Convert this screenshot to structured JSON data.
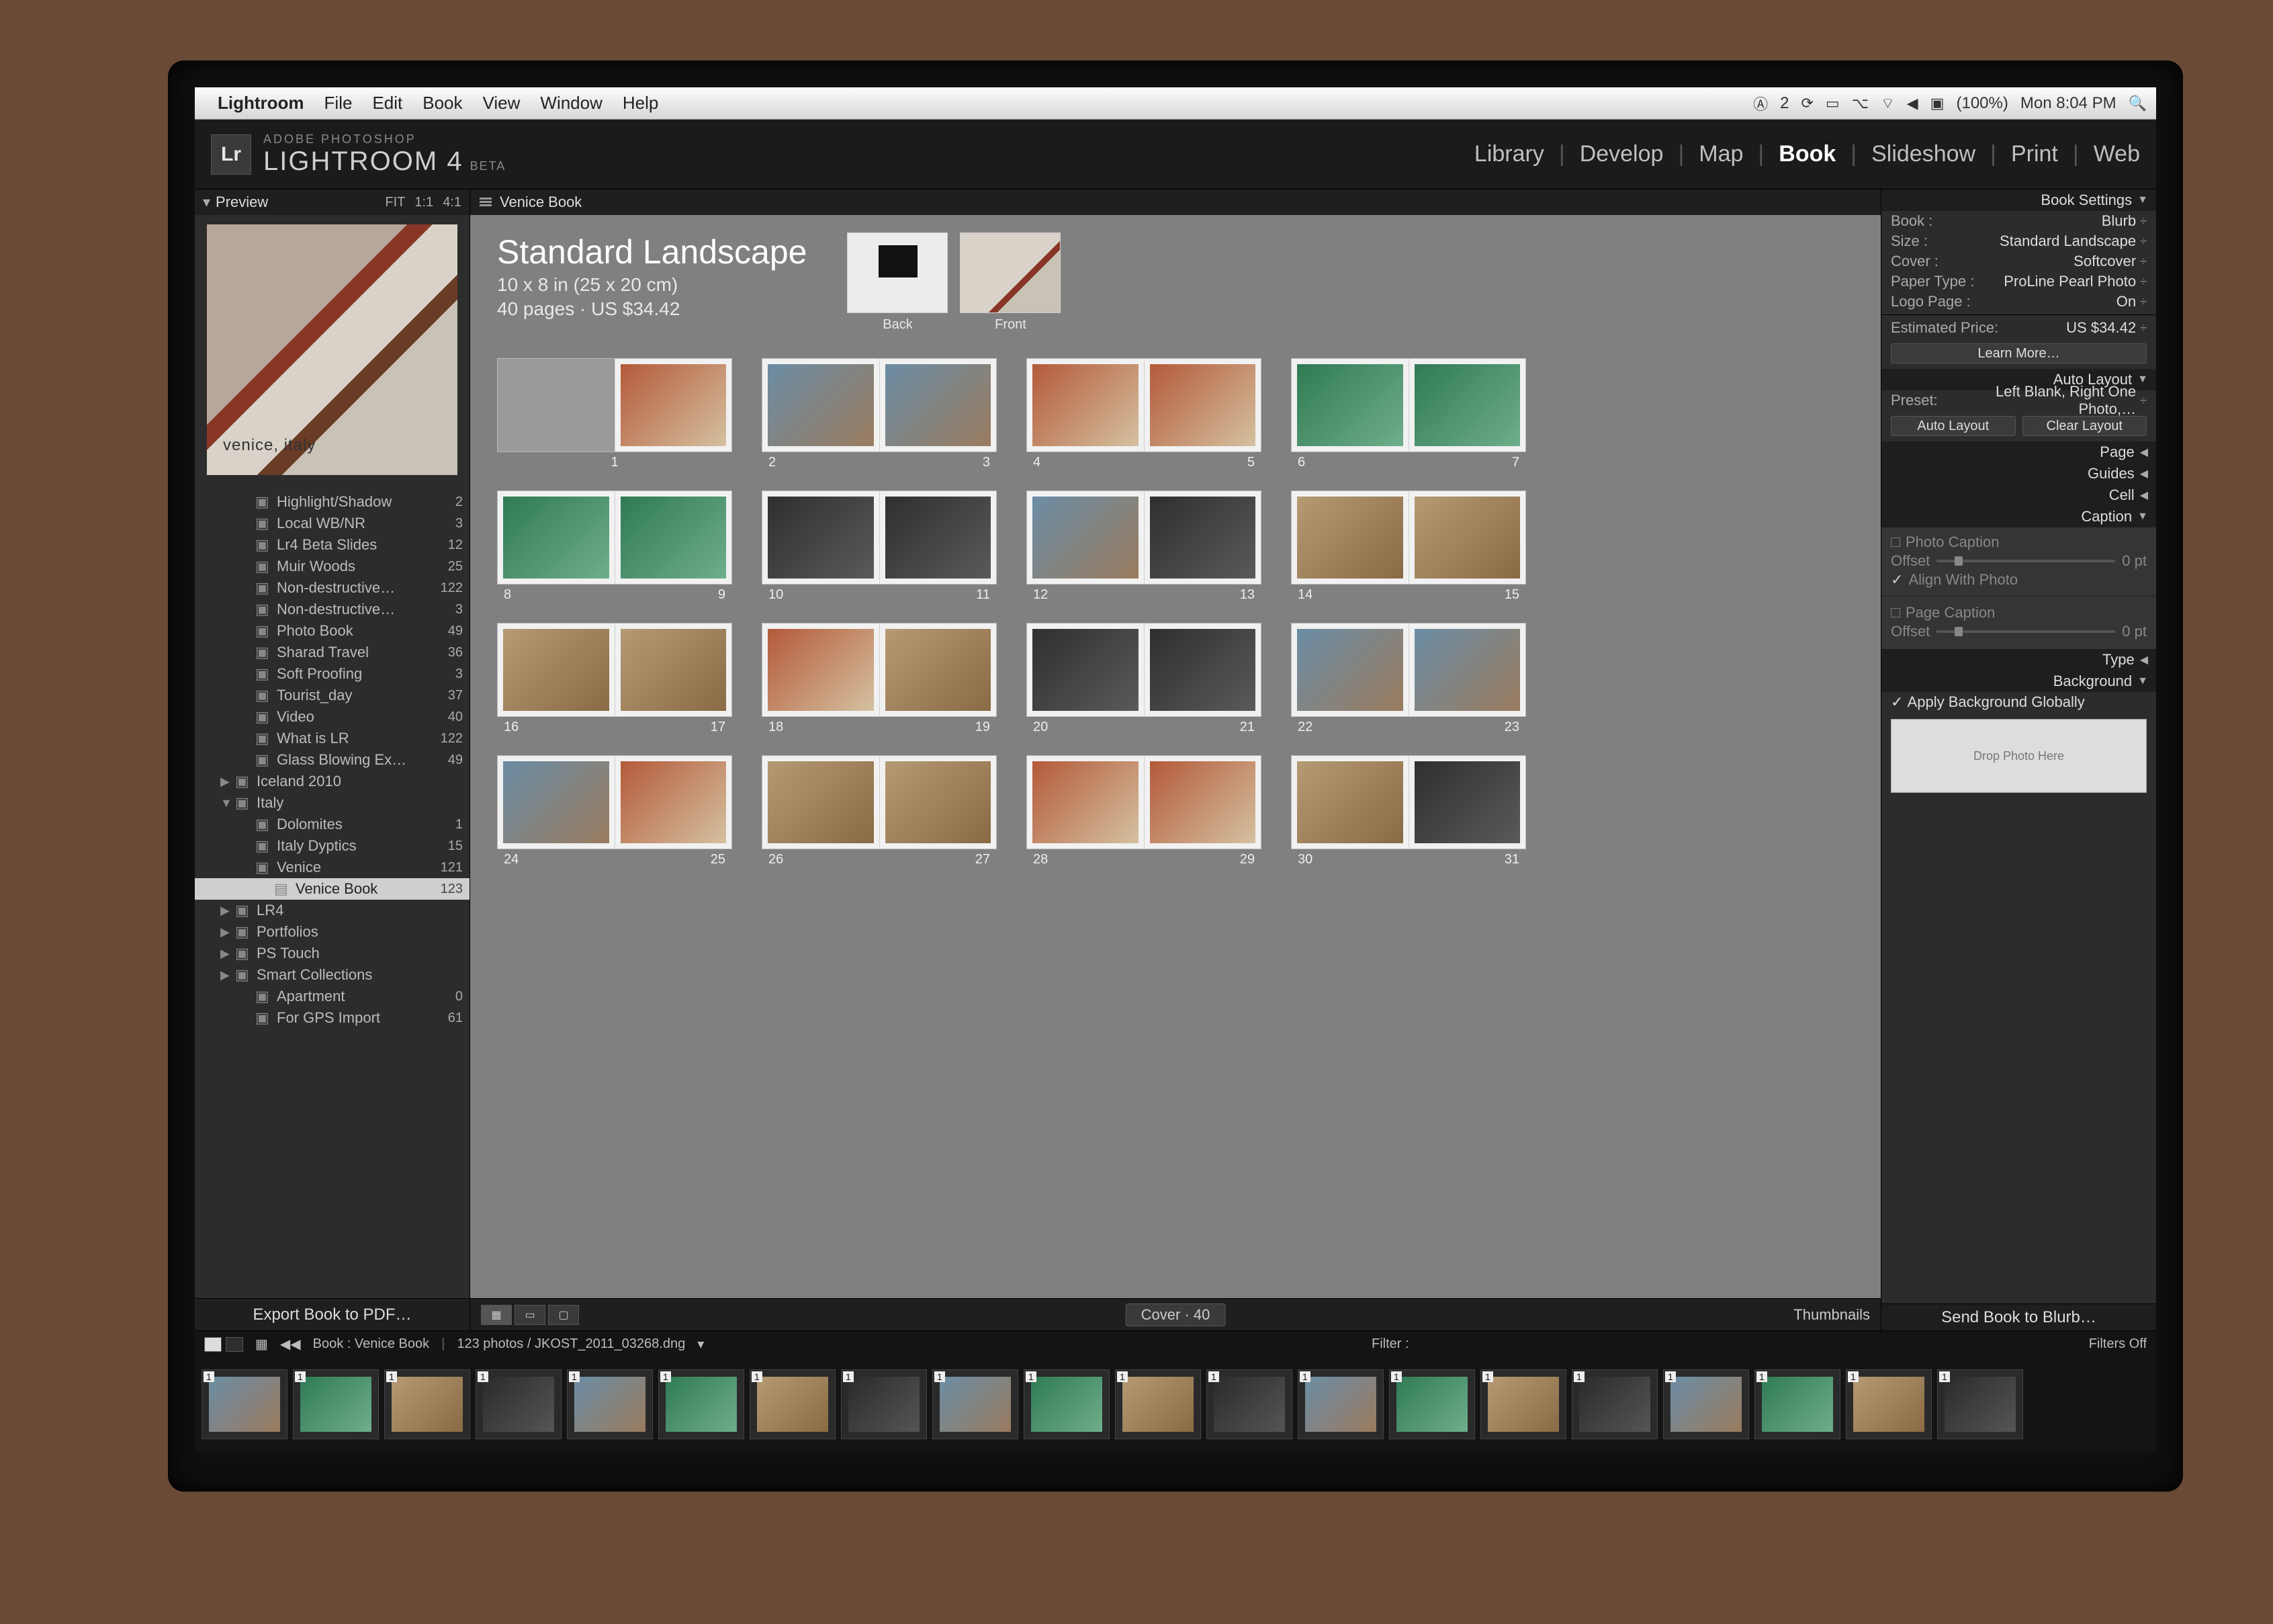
{
  "mac_menu": {
    "app": "Lightroom",
    "items": [
      "File",
      "Edit",
      "Book",
      "View",
      "Window",
      "Help"
    ],
    "status": {
      "a_count": "2",
      "battery": "(100%)",
      "clock": "Mon 8:04 PM"
    }
  },
  "app_header": {
    "badge": "Lr",
    "line1": "ADOBE PHOTOSHOP",
    "line2": "LIGHTROOM 4",
    "beta": "BETA",
    "modules": [
      "Library",
      "Develop",
      "Map",
      "Book",
      "Slideshow",
      "Print",
      "Web"
    ],
    "active_module": "Book"
  },
  "left": {
    "preview_label": "Preview",
    "zoom": [
      "FIT",
      "1:1",
      "4:1"
    ],
    "preview_caption": "venice, italy",
    "collections": [
      {
        "name": "Highlight/Shadow",
        "count": "2",
        "indent": 2
      },
      {
        "name": "Local WB/NR",
        "count": "3",
        "indent": 2
      },
      {
        "name": "Lr4 Beta Slides",
        "count": "12",
        "indent": 2
      },
      {
        "name": "Muir Woods",
        "count": "25",
        "indent": 2
      },
      {
        "name": "Non-destructive…",
        "count": "122",
        "indent": 2
      },
      {
        "name": "Non-destructive…",
        "count": "3",
        "indent": 2
      },
      {
        "name": "Photo Book",
        "count": "49",
        "indent": 2
      },
      {
        "name": "Sharad Travel",
        "count": "36",
        "indent": 2
      },
      {
        "name": "Soft Proofing",
        "count": "3",
        "indent": 2
      },
      {
        "name": "Tourist_day",
        "count": "37",
        "indent": 2
      },
      {
        "name": "Video",
        "count": "40",
        "indent": 2
      },
      {
        "name": "What is LR",
        "count": "122",
        "indent": 2
      },
      {
        "name": "Glass Blowing Ex…",
        "count": "49",
        "indent": 2
      },
      {
        "name": "Iceland 2010",
        "count": "",
        "indent": 1,
        "expandable": true
      },
      {
        "name": "Italy",
        "count": "",
        "indent": 1,
        "expandable": true,
        "open": true
      },
      {
        "name": "Dolomites",
        "count": "1",
        "indent": 2
      },
      {
        "name": "Italy Dyptics",
        "count": "15",
        "indent": 2
      },
      {
        "name": "Venice",
        "count": "121",
        "indent": 2
      },
      {
        "name": "Venice Book",
        "count": "123",
        "indent": 3,
        "active": true,
        "book": true
      },
      {
        "name": "LR4",
        "count": "",
        "indent": 1,
        "expandable": true
      },
      {
        "name": "Portfolios",
        "count": "",
        "indent": 1,
        "expandable": true
      },
      {
        "name": "PS Touch",
        "count": "",
        "indent": 1,
        "expandable": true
      },
      {
        "name": "Smart Collections",
        "count": "",
        "indent": 1,
        "expandable": true
      },
      {
        "name": "Apartment",
        "count": "0",
        "indent": 2
      },
      {
        "name": "For GPS Import",
        "count": "61",
        "indent": 2
      }
    ],
    "footer_btn": "Export Book to PDF…"
  },
  "center": {
    "book_name": "Venice Book",
    "title": "Standard Landscape",
    "dims": "10 x 8 in (25 x 20 cm)",
    "pages_price": "40 pages · US $34.42",
    "cover_back": "Back",
    "cover_front": "Front",
    "page_status": "Cover · 40",
    "thumbnails_label": "Thumbnails",
    "spread_rows": [
      [
        {
          "l": "",
          "r": "1",
          "blankL": true,
          "cls": "alt"
        },
        {
          "l": "2",
          "r": "3",
          "cls": "",
          "cls2": ""
        },
        {
          "l": "4",
          "r": "5",
          "cls": "alt",
          "cls2": "alt"
        },
        {
          "l": "6",
          "r": "7",
          "cls": "green",
          "cls2": ""
        }
      ],
      [
        {
          "l": "8",
          "r": "9",
          "cls": "green",
          "cls2": "green"
        },
        {
          "l": "10",
          "r": "11",
          "cls": "dark",
          "cls2": "dark"
        },
        {
          "l": "12",
          "r": "13",
          "cls": "",
          "cls2": "dark"
        },
        {
          "l": "14",
          "r": "15",
          "cls": "warm",
          "cls2": "warm"
        }
      ],
      [
        {
          "l": "16",
          "r": "17",
          "cls": "warm",
          "cls2": "warm"
        },
        {
          "l": "18",
          "r": "19",
          "cls": "alt",
          "cls2": "warm"
        },
        {
          "l": "20",
          "r": "21",
          "cls": "dark",
          "cls2": "dark"
        },
        {
          "l": "22",
          "r": "23",
          "cls": "",
          "cls2": ""
        }
      ],
      [
        {
          "l": "24",
          "r": "25",
          "cls": "",
          "cls2": "alt"
        },
        {
          "l": "26",
          "r": "27",
          "cls": "warm",
          "cls2": "warm"
        },
        {
          "l": "28",
          "r": "29",
          "cls": "alt",
          "cls2": "alt"
        },
        {
          "l": "30",
          "r": "31",
          "cls": "warm",
          "cls2": "dark"
        }
      ]
    ]
  },
  "right": {
    "settings_header": "Book Settings",
    "book_kv": [
      {
        "k": "Book :",
        "v": "Blurb"
      },
      {
        "k": "Size :",
        "v": "Standard Landscape"
      },
      {
        "k": "Cover :",
        "v": "Softcover"
      },
      {
        "k": "Paper Type :",
        "v": "ProLine Pearl Photo"
      },
      {
        "k": "Logo Page :",
        "v": "On"
      }
    ],
    "est_price_k": "Estimated Price:",
    "est_price_v": "US $34.42",
    "learn_more": "Learn More…",
    "auto_layout_header": "Auto Layout",
    "preset_k": "Preset:",
    "preset_v": "Left Blank, Right One Photo,…",
    "auto_layout_btn": "Auto Layout",
    "clear_layout_btn": "Clear Layout",
    "page_header": "Page",
    "guides_header": "Guides",
    "cell_header": "Cell",
    "caption_header": "Caption",
    "photo_caption": "Photo Caption",
    "offset_label": "Offset",
    "offset_val": "0 pt",
    "align_with_photo": "Align With Photo",
    "page_caption": "Page Caption",
    "type_header": "Type",
    "background_header": "Background",
    "apply_bg_global": "Apply Background Globally",
    "drop_photo": "Drop Photo Here",
    "send_btn": "Send Book to Blurb…"
  },
  "filmstrip": {
    "crumb": "Book : Venice Book",
    "count_label": "123 photos / JKOST_2011_03268.dng",
    "filter_label": "Filter :",
    "filters_off": "Filters Off",
    "badge": "1",
    "thumbs": 20
  }
}
